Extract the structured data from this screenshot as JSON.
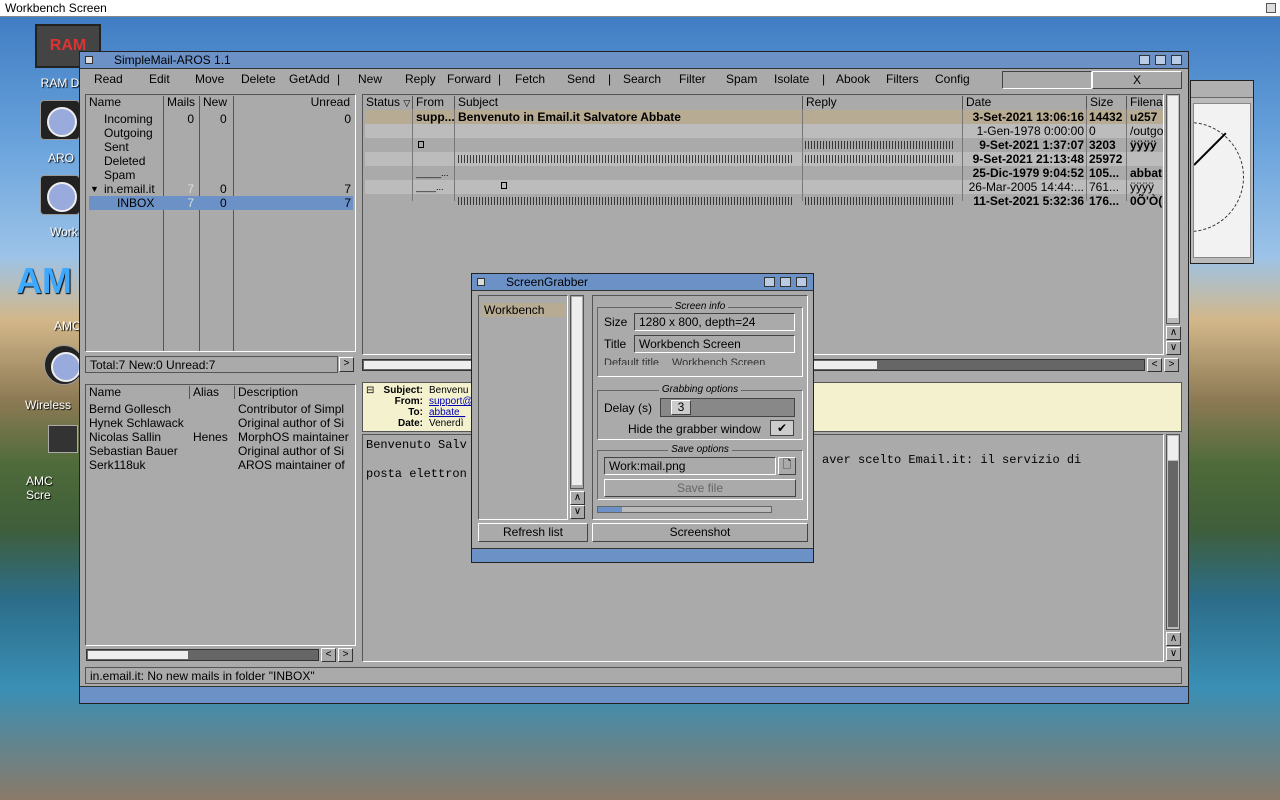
{
  "screen": {
    "title": "Workbench Screen"
  },
  "desktop": {
    "icons": [
      {
        "label": "RAM D",
        "badge": "RAM"
      },
      {
        "label": "ARO"
      },
      {
        "label": "Work"
      },
      {
        "label": "AMC",
        "badge": "AM"
      },
      {
        "label": "Wireless"
      },
      {
        "label": "AMC Scre"
      }
    ]
  },
  "mainwin": {
    "title": "SimpleMail-AROS 1.1"
  },
  "menu": {
    "read": "Read",
    "edit": "Edit",
    "move": "Move",
    "delete": "Delete",
    "getadd": "GetAdd",
    "sep": "|",
    "new": "New",
    "reply": "Reply",
    "forward": "Forward",
    "fetch": "Fetch",
    "send": "Send",
    "search": "Search",
    "filter": "Filter",
    "spam": "Spam",
    "isolate": "Isolate",
    "abook": "Abook",
    "filters": "Filters",
    "config": "Config",
    "search_value": "",
    "clear": "X"
  },
  "folders": {
    "headers": [
      "Name",
      "Mails",
      "New",
      "Unread"
    ],
    "rows": [
      {
        "name": "Incoming",
        "mails": "0",
        "new": "0",
        "unread": "0"
      },
      {
        "name": "Outgoing",
        "mails": "",
        "new": "",
        "unread": ""
      },
      {
        "name": "Sent",
        "mails": "",
        "new": "",
        "unread": ""
      },
      {
        "name": "Deleted",
        "mails": "",
        "new": "",
        "unread": ""
      },
      {
        "name": "Spam",
        "mails": "",
        "new": "",
        "unread": ""
      },
      {
        "name": "in.email.it",
        "mails": "7",
        "new": "0",
        "unread": "7"
      },
      {
        "name": "INBOX",
        "mails": "7",
        "new": "0",
        "unread": "7"
      }
    ],
    "summary": "Total:7 New:0 Unread:7",
    "summary_btn": ">"
  },
  "addressbook": {
    "headers": [
      "Name",
      "Alias",
      "Description"
    ],
    "rows": [
      {
        "name": "Bernd Gollesch",
        "alias": "",
        "desc": "Contributor of Simpl"
      },
      {
        "name": "Hynek Schlawack",
        "alias": "",
        "desc": "Original author of Si"
      },
      {
        "name": "Nicolas Sallin",
        "alias": "Henes",
        "desc": "MorphOS maintainer"
      },
      {
        "name": "Sebastian Bauer",
        "alias": "",
        "desc": "Original author of Si"
      },
      {
        "name": "Serk118uk",
        "alias": "",
        "desc": "AROS maintainer of"
      }
    ],
    "arrows": [
      "<",
      ">"
    ]
  },
  "maillist": {
    "headers": [
      "Status",
      "From",
      "Subject",
      "Reply",
      "Date",
      "Size",
      "Filena"
    ],
    "sort_icon": "▽",
    "rows": [
      {
        "from": "supp...",
        "subject": "Benvenuto in Email.it Salvatore Abbate",
        "date": "3-Set-2021 13:06:16",
        "size": "14432",
        "file": "u257",
        "bold": true
      },
      {
        "from": "",
        "subject": "",
        "date": "1-Gen-1978 0:00:00",
        "size": "0",
        "file": "/outgo",
        "bold": false
      },
      {
        "from": "",
        "subject": "",
        "date": "9-Set-2021 1:37:07",
        "size": "3203",
        "file": "ÿÿÿÿ",
        "bold": true
      },
      {
        "from": "",
        "subject": "",
        "date": "9-Set-2021 21:13:48",
        "size": "25972",
        "file": "",
        "bold": true
      },
      {
        "from": "_____...",
        "subject": "",
        "date": "25-Dic-1979 9:04:52",
        "size": "105...",
        "file": "abbat",
        "bold": true
      },
      {
        "from": "____...",
        "subject": "",
        "date": "26-Mar-2005 14:44:...",
        "size": "761...",
        "file": "ÿÿÿÿ",
        "bold": false
      },
      {
        "from": "",
        "subject": "",
        "date": "11-Set-2021 5:32:36",
        "size": "176...",
        "file": "0Õ'Ò(",
        "bold": true
      }
    ]
  },
  "preview": {
    "header_labels": [
      "Subject:",
      "From:",
      "To:",
      "Date:"
    ],
    "header_values": [
      "Benvenu",
      "support@",
      "abbate_",
      "Venerdì"
    ],
    "collapse": "⊟",
    "body_left": [
      "Benvenuto Salv",
      "posta elettron"
    ],
    "body_right": "aver scelto Email.it: il servizio di"
  },
  "statusbar": "in.email.it: No new mails in folder \"INBOX\"",
  "grabber": {
    "title": "ScreenGrabber",
    "screens": [
      "Workbench"
    ],
    "info_title": "Screen info",
    "size_label": "Size",
    "size_value": "1280 x 800, depth=24",
    "title_label": "Title",
    "title_value": "Workbench Screen",
    "default_label": "Default title",
    "default_value": "Workbench Screen",
    "grab_title": "Grabbing options",
    "delay_label": "Delay (s)",
    "delay_value": "3",
    "hide_label": "Hide the grabber window",
    "hide_check": "✔",
    "save_title": "Save options",
    "file_value": "Work:mail.png",
    "save_btn": "Save file",
    "progress": 0.14,
    "refresh_btn": "Refresh list",
    "shot_btn": "Screenshot"
  }
}
